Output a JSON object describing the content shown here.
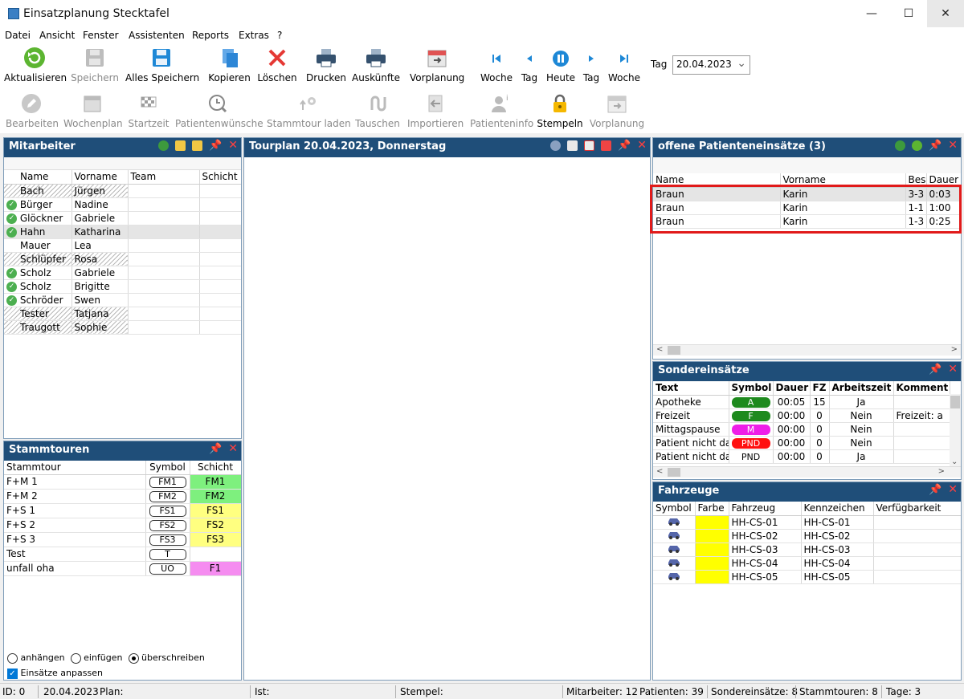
{
  "window": {
    "title": "Einsatzplanung Stecktafel",
    "min": "—",
    "max": "☐",
    "close": "✕"
  },
  "menu": [
    "Datei",
    "Ansicht",
    "Fenster",
    "Assistenten",
    "Reports",
    "Extras",
    "?"
  ],
  "toolbar": {
    "row1": [
      {
        "label": "Aktualisieren",
        "icon": "refresh-icon"
      },
      {
        "label": "Speichern",
        "icon": "save-icon"
      },
      {
        "label": "Alles Speichern",
        "icon": "save-all-icon"
      },
      {
        "label": "Kopieren",
        "icon": "copy-icon"
      },
      {
        "label": "Löschen",
        "icon": "delete-icon"
      },
      {
        "label": "Drucken",
        "icon": "print-icon"
      },
      {
        "label": "Auskünfte",
        "icon": "print-info-icon"
      },
      {
        "label": "Vorplanung",
        "icon": "calendar-forward-icon"
      }
    ],
    "nav": [
      {
        "label": "Woche",
        "icon": "skip-back-icon"
      },
      {
        "label": "Tag",
        "icon": "prev-icon"
      },
      {
        "label": "Heute",
        "icon": "pause-icon"
      },
      {
        "label": "Tag",
        "icon": "next-icon"
      },
      {
        "label": "Woche",
        "icon": "skip-forward-icon"
      }
    ],
    "date_label": "Tag",
    "date_value": "20.04.2023",
    "row2": [
      {
        "label": "Bearbeiten",
        "icon": "edit-icon"
      },
      {
        "label": "Wochenplan",
        "icon": "calendar-icon"
      },
      {
        "label": "Startzeit",
        "icon": "checkered-flag-icon"
      },
      {
        "label": "Patientenwünsche",
        "icon": "clock-search-icon"
      },
      {
        "label": "Stammtour laden",
        "icon": "load-route-icon"
      },
      {
        "label": "Tauschen",
        "icon": "swap-icon"
      },
      {
        "label": "Importieren",
        "icon": "import-icon"
      },
      {
        "label": "Patienteninfo",
        "icon": "patient-info-icon"
      },
      {
        "label": "Stempeln",
        "icon": "lock-icon"
      },
      {
        "label": "Vorplanung",
        "icon": "calendar-forward-icon"
      }
    ]
  },
  "mitarbeiter": {
    "title": "Mitarbeiter",
    "columns": [
      "Name",
      "Vorname",
      "Team",
      "Schicht"
    ],
    "rows": [
      {
        "name": "Bach",
        "vorname": "Jürgen",
        "check": false,
        "hatch": true
      },
      {
        "name": "Bürger",
        "vorname": "Nadine",
        "check": true,
        "hatch": false
      },
      {
        "name": "Glöckner",
        "vorname": "Gabriele",
        "check": true,
        "hatch": false
      },
      {
        "name": "Hahn",
        "vorname": "Katharina",
        "check": true,
        "hatch": false,
        "selected": true
      },
      {
        "name": "Mauer",
        "vorname": "Lea",
        "check": false,
        "hatch": false
      },
      {
        "name": "Schlüpfer",
        "vorname": "Rosa",
        "check": false,
        "hatch": true
      },
      {
        "name": "Scholz",
        "vorname": "Gabriele",
        "check": true,
        "hatch": false
      },
      {
        "name": "Scholz",
        "vorname": "Brigitte",
        "check": true,
        "hatch": false
      },
      {
        "name": "Schröder",
        "vorname": "Swen",
        "check": true,
        "hatch": false
      },
      {
        "name": "Tester",
        "vorname": "Tatjana",
        "check": false,
        "hatch": true
      },
      {
        "name": "Traugott",
        "vorname": "Sophie",
        "check": false,
        "hatch": true
      }
    ]
  },
  "stammtouren": {
    "title": "Stammtouren",
    "columns": [
      "Stammtour",
      "Symbol",
      "Schicht"
    ],
    "rows": [
      {
        "tour": "F+M 1",
        "symbol": "FM1",
        "schicht": "FM1",
        "color": "#7ef07e"
      },
      {
        "tour": "F+M 2",
        "symbol": "FM2",
        "schicht": "FM2",
        "color": "#7ef07e"
      },
      {
        "tour": "F+S 1",
        "symbol": "FS1",
        "schicht": "FS1",
        "color": "#ffff80"
      },
      {
        "tour": "F+S 2",
        "symbol": "FS2",
        "schicht": "FS2",
        "color": "#ffff80"
      },
      {
        "tour": "F+S 3",
        "symbol": "FS3",
        "schicht": "FS3",
        "color": "#ffff80"
      },
      {
        "tour": "Test",
        "symbol": "T",
        "schicht": "",
        "color": ""
      },
      {
        "tour": "unfall oha",
        "symbol": "UO",
        "schicht": "F1",
        "color": "#f58cf0"
      }
    ],
    "options": [
      "anhängen",
      "einfügen",
      "überschreiben"
    ],
    "checkbox": "Einsätze anpassen"
  },
  "tourplan": {
    "title": "Tourplan 20.04.2023, Donnerstag"
  },
  "offene": {
    "title": "offene Patienteneinsätze (3)",
    "columns": [
      "Name",
      "Vorname",
      "Bes",
      "Dauer"
    ],
    "rows": [
      {
        "name": "Braun",
        "vorname": "Karin",
        "bes": "3-3",
        "dauer": "0:03"
      },
      {
        "name": "Braun",
        "vorname": "Karin",
        "bes": "1-1",
        "dauer": "1:00"
      },
      {
        "name": "Braun",
        "vorname": "Karin",
        "bes": "1-3",
        "dauer": "0:25"
      }
    ]
  },
  "sonder": {
    "title": "Sondereinsätze",
    "columns": [
      "Text",
      "Symbol",
      "Dauer",
      "FZ",
      "Arbeitszeit",
      "Komment"
    ],
    "rows": [
      {
        "text": "Apotheke",
        "symbol": "A",
        "color": "#1e8a1e",
        "dauer": "00:05",
        "fz": "15",
        "az": "Ja",
        "komm": ""
      },
      {
        "text": "Freizeit",
        "symbol": "F",
        "color": "#1e8a1e",
        "dauer": "00:00",
        "fz": "0",
        "az": "Nein",
        "komm": "Freizeit: a"
      },
      {
        "text": "Mittagspause",
        "symbol": "M",
        "color": "#ee1ee8",
        "dauer": "00:00",
        "fz": "0",
        "az": "Nein",
        "komm": ""
      },
      {
        "text": "Patient nicht da",
        "symbol": "PND",
        "color": "#ff1010",
        "dauer": "00:00",
        "fz": "0",
        "az": "Nein",
        "komm": ""
      },
      {
        "text": "Patient nicht da",
        "symbol": "PND",
        "color": "",
        "dauer": "00:00",
        "fz": "0",
        "az": "Ja",
        "komm": ""
      }
    ]
  },
  "fahrzeuge": {
    "title": "Fahrzeuge",
    "columns": [
      "Symbol",
      "Farbe",
      "Fahrzeug",
      "Kennzeichen",
      "Verfügbarkeit"
    ],
    "rows": [
      {
        "fahrzeug": "HH-CS-01",
        "kennzeichen": "HH-CS-01",
        "color": "#ffff00"
      },
      {
        "fahrzeug": "HH-CS-02",
        "kennzeichen": "HH-CS-02",
        "color": "#ffff00"
      },
      {
        "fahrzeug": "HH-CS-03",
        "kennzeichen": "HH-CS-03",
        "color": "#ffff00"
      },
      {
        "fahrzeug": "HH-CS-04",
        "kennzeichen": "HH-CS-04",
        "color": "#ffff00"
      },
      {
        "fahrzeug": "HH-CS-05",
        "kennzeichen": "HH-CS-05",
        "color": "#ffff00"
      }
    ]
  },
  "status": {
    "id": "ID: 0",
    "date": "20.04.2023",
    "plan": "Plan:",
    "ist": "Ist:",
    "stempel": "Stempel:",
    "mitarbeiter": "Mitarbeiter: 12",
    "patienten": "Patienten: 39",
    "sonder": "Sondereinsätze: 8",
    "stammtouren": "Stammtouren: 8",
    "tage": "Tage: 3"
  }
}
